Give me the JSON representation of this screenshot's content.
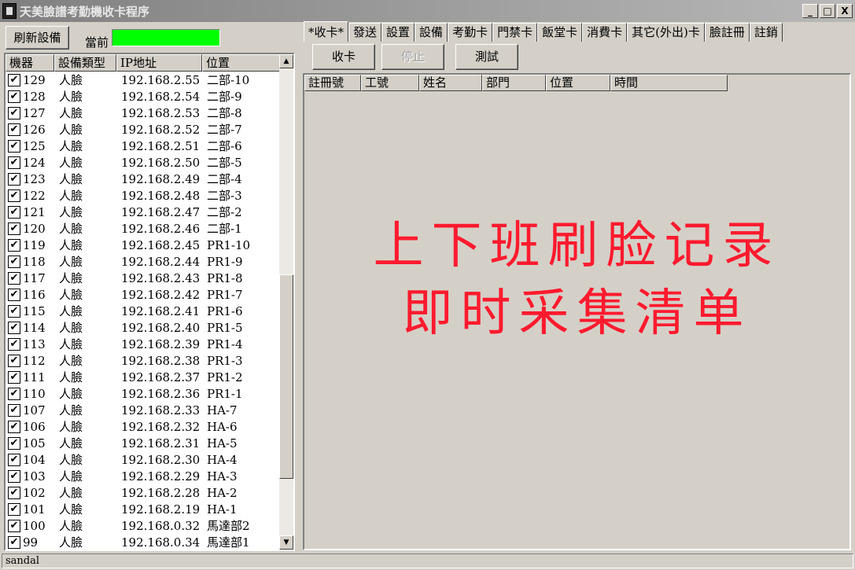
{
  "window": {
    "title": "天美臉譜考勤機收卡程序",
    "controls": [
      "_",
      "□",
      "X"
    ]
  },
  "left_toolbar": {
    "refresh_label": "刷新設備",
    "current_label": "當前",
    "indicator_color": "#00ff00"
  },
  "device_list": {
    "columns": [
      "機器",
      "設備類型",
      "IP地址",
      "位置"
    ],
    "rows": [
      {
        "id": "129",
        "type": "人臉",
        "ip": "192.168.2.55",
        "pos": "二部-10"
      },
      {
        "id": "128",
        "type": "人臉",
        "ip": "192.168.2.54",
        "pos": "二部-9"
      },
      {
        "id": "127",
        "type": "人臉",
        "ip": "192.168.2.53",
        "pos": "二部-8"
      },
      {
        "id": "126",
        "type": "人臉",
        "ip": "192.168.2.52",
        "pos": "二部-7"
      },
      {
        "id": "125",
        "type": "人臉",
        "ip": "192.168.2.51",
        "pos": "二部-6"
      },
      {
        "id": "124",
        "type": "人臉",
        "ip": "192.168.2.50",
        "pos": "二部-5"
      },
      {
        "id": "123",
        "type": "人臉",
        "ip": "192.168.2.49",
        "pos": "二部-4"
      },
      {
        "id": "122",
        "type": "人臉",
        "ip": "192.168.2.48",
        "pos": "二部-3"
      },
      {
        "id": "121",
        "type": "人臉",
        "ip": "192.168.2.47",
        "pos": "二部-2"
      },
      {
        "id": "120",
        "type": "人臉",
        "ip": "192.168.2.46",
        "pos": "二部-1"
      },
      {
        "id": "119",
        "type": "人臉",
        "ip": "192.168.2.45",
        "pos": "PR1-10"
      },
      {
        "id": "118",
        "type": "人臉",
        "ip": "192.168.2.44",
        "pos": "PR1-9"
      },
      {
        "id": "117",
        "type": "人臉",
        "ip": "192.168.2.43",
        "pos": "PR1-8"
      },
      {
        "id": "116",
        "type": "人臉",
        "ip": "192.168.2.42",
        "pos": "PR1-7"
      },
      {
        "id": "115",
        "type": "人臉",
        "ip": "192.168.2.41",
        "pos": "PR1-6"
      },
      {
        "id": "114",
        "type": "人臉",
        "ip": "192.168.2.40",
        "pos": "PR1-5"
      },
      {
        "id": "113",
        "type": "人臉",
        "ip": "192.168.2.39",
        "pos": "PR1-4"
      },
      {
        "id": "112",
        "type": "人臉",
        "ip": "192.168.2.38",
        "pos": "PR1-3"
      },
      {
        "id": "111",
        "type": "人臉",
        "ip": "192.168.2.37",
        "pos": "PR1-2"
      },
      {
        "id": "110",
        "type": "人臉",
        "ip": "192.168.2.36",
        "pos": "PR1-1"
      },
      {
        "id": "107",
        "type": "人臉",
        "ip": "192.168.2.33",
        "pos": "HA-7"
      },
      {
        "id": "106",
        "type": "人臉",
        "ip": "192.168.2.32",
        "pos": "HA-6"
      },
      {
        "id": "105",
        "type": "人臉",
        "ip": "192.168.2.31",
        "pos": "HA-5"
      },
      {
        "id": "104",
        "type": "人臉",
        "ip": "192.168.2.30",
        "pos": "HA-4"
      },
      {
        "id": "103",
        "type": "人臉",
        "ip": "192.168.2.29",
        "pos": "HA-3"
      },
      {
        "id": "102",
        "type": "人臉",
        "ip": "192.168.2.28",
        "pos": "HA-2"
      },
      {
        "id": "101",
        "type": "人臉",
        "ip": "192.168.2.19",
        "pos": "HA-1"
      },
      {
        "id": "100",
        "type": "人臉",
        "ip": "192.168.0.32",
        "pos": "馬達部2"
      },
      {
        "id": "99",
        "type": "人臉",
        "ip": "192.168.0.34",
        "pos": "馬達部1"
      }
    ],
    "checked": true,
    "check_glyph": "✔"
  },
  "tabs": [
    "*收卡*",
    "發送",
    "設置",
    "設備",
    "考勤卡",
    "門禁卡",
    "飯堂卡",
    "消費卡",
    "其它(外出)卡",
    "臉註冊",
    "註銷"
  ],
  "actions": {
    "collect": "收卡",
    "stop": "停止",
    "test": "測試"
  },
  "records_table": {
    "columns": [
      "註冊號",
      "工號",
      "姓名",
      "部門",
      "位置",
      "時間"
    ]
  },
  "overlay": {
    "line1": "上下班刷脸记录",
    "line2": "即时采集清单",
    "color": "#ff1a2e"
  },
  "statusbar": {
    "text": "sandal"
  }
}
